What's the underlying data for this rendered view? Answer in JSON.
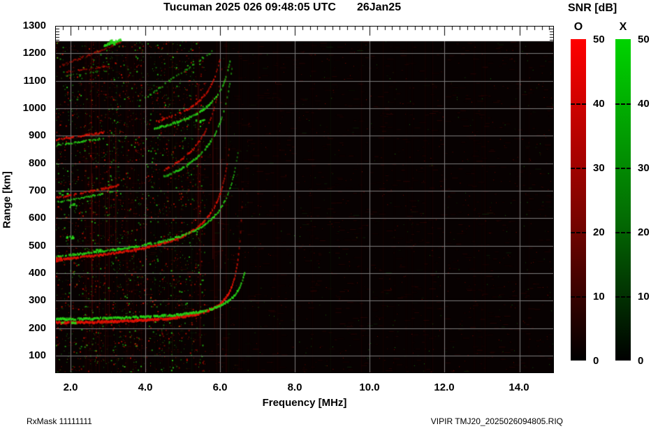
{
  "header": {
    "title": "Tucuman 2025 026 09:48:05 UTC",
    "date": "26Jan25"
  },
  "axes": {
    "x": {
      "label": "Frequency [MHz]",
      "ticks": [
        "2.0",
        "4.0",
        "6.0",
        "8.0",
        "10.0",
        "12.0",
        "14.0"
      ],
      "tick_values": [
        2,
        4,
        6,
        8,
        10,
        12,
        14
      ],
      "min": 1.6,
      "max": 15.0,
      "minor_step": 0.2
    },
    "y": {
      "label": "Range [km]",
      "ticks": [
        "1300",
        "1200",
        "1100",
        "1000",
        "900",
        "800",
        "700",
        "600",
        "500",
        "400",
        "300",
        "200",
        "100"
      ],
      "tick_values": [
        1300,
        1200,
        1100,
        1000,
        900,
        800,
        700,
        600,
        500,
        400,
        300,
        200,
        100
      ],
      "min": 30,
      "max": 1300,
      "minor_step": 10
    }
  },
  "legend": {
    "title": "SNR [dB]",
    "o_label": "O",
    "x_label": "X",
    "ticks": [
      "50",
      "40",
      "30",
      "20",
      "10",
      "0"
    ],
    "tick_values": [
      50,
      40,
      30,
      20,
      10,
      0
    ],
    "o_color_top": "#ff0000",
    "x_color_top": "#00d400",
    "bottom_color": "#000000",
    "min": 0,
    "max": 50
  },
  "footer": {
    "left": "RxMask 11111111",
    "right": "VIPIR  TMJ20_2025026094805.RIQ"
  },
  "chart_data": {
    "type": "heatmap",
    "title": "Tucuman 2025 026 09:48:05 UTC",
    "date": "26Jan25",
    "xlabel": "Frequency [MHz]",
    "ylabel": "Range [km]",
    "zlabel": "SNR [dB]",
    "x_range": [
      1.6,
      15.0
    ],
    "y_range": [
      30,
      1300
    ],
    "z_range": [
      0,
      50
    ],
    "x_gridlines": [
      2,
      4,
      6,
      8,
      10,
      12,
      14
    ],
    "y_gridlines": [
      100,
      200,
      300,
      400,
      500,
      600,
      700,
      800,
      900,
      1000,
      1100,
      1200
    ],
    "grid_color": "#7c7c7c",
    "background": "#070101",
    "no_data_band_km": [
      1245,
      1300
    ],
    "modes": {
      "o": {
        "name": "O",
        "color": "#ff1600"
      },
      "x": {
        "name": "X",
        "color": "#2bd41c"
      }
    },
    "critical_frequency_MHz": {
      "o_mode": 6.7,
      "x_mode": 7.0
    },
    "echo_traces": [
      {
        "hop": 1,
        "base_km": 219,
        "c": 58,
        "fc_o": 6.72,
        "tilt": 0,
        "segs": [
          [
            1.6,
            6.68
          ]
        ],
        "alpha": 1.0,
        "thick": 3.5,
        "patch": 0.95,
        "x_dr": 13,
        "rmax": 770,
        "points_o": [
          [
            1.6,
            219
          ],
          [
            3.0,
            224
          ],
          [
            5.0,
            242
          ],
          [
            6.0,
            288
          ],
          [
            6.5,
            471
          ],
          [
            6.65,
            740
          ]
        ]
      },
      {
        "hop": 2,
        "base_km": 447,
        "c": 140,
        "fc_o": 6.6,
        "tilt": 8,
        "segs": [
          [
            1.6,
            6.55
          ]
        ],
        "alpha": 0.95,
        "thick": 3.0,
        "patch": 0.85,
        "x_dr": 14,
        "rmax": 870,
        "points_o": [
          [
            1.6,
            447
          ],
          [
            3.0,
            462
          ],
          [
            4.2,
            498
          ],
          [
            5.0,
            520
          ],
          [
            6.0,
            665
          ],
          [
            6.4,
            860
          ]
        ]
      },
      {
        "hop": 3,
        "base_km": 673,
        "c": 200,
        "fc_o": 6.5,
        "tilt": 15,
        "segs": [
          [
            1.6,
            3.3
          ],
          [
            4.5,
            6.45
          ]
        ],
        "alpha": 0.8,
        "thick": 2.6,
        "patch": 0.6,
        "x_dr": -16,
        "rmax": 1150,
        "points_o": [
          [
            1.6,
            673
          ],
          [
            3.0,
            711
          ],
          [
            4.5,
            776
          ],
          [
            5.5,
            891
          ],
          [
            6.0,
            1099
          ]
        ]
      },
      {
        "hop": 4,
        "base_km": 885,
        "c": 100,
        "fc_o": 6.4,
        "tilt": 15,
        "segs": [
          [
            1.6,
            2.9
          ],
          [
            4.25,
            6.3
          ]
        ],
        "alpha": 0.9,
        "thick": 2.6,
        "patch": 0.65,
        "x_dr": -20,
        "rmax": 1180,
        "points_o": [
          [
            1.6,
            885
          ],
          [
            2.5,
            902
          ],
          [
            4.5,
            964
          ],
          [
            5.8,
            1115
          ]
        ]
      },
      {
        "hop": 5,
        "base_km": 1128,
        "c": 120,
        "fc_o": 6.3,
        "tilt": 10,
        "segs": [
          [
            1.9,
            3.1
          ]
        ],
        "alpha": 0.5,
        "thick": 2.0,
        "patch": 0.5,
        "x_dr": -14,
        "rmax": 1160,
        "points_o": [
          [
            1.9,
            1131
          ],
          [
            3.1,
            1155
          ]
        ]
      }
    ],
    "streaks": [
      {
        "pts": [
          [
            1.7,
            1152
          ],
          [
            3.35,
            1240
          ]
        ],
        "mode": "o",
        "alpha": 0.5,
        "thick": 2.5,
        "patch": 0.7
      },
      {
        "pts": [
          [
            4.0,
            1038
          ],
          [
            5.78,
            1205
          ]
        ],
        "mode": "x",
        "alpha": 0.7,
        "thick": 2.5,
        "patch": 0.45
      },
      {
        "pts": [
          [
            2.9,
            1228
          ],
          [
            3.35,
            1250
          ]
        ],
        "mode": "x",
        "alpha": 0.85,
        "thick": 2.5,
        "patch": 0.6
      }
    ],
    "blobs": [
      {
        "f": 1.78,
        "r": 232,
        "mode": "x",
        "s": 4,
        "n": 7
      },
      {
        "f": 2.08,
        "r": 228,
        "mode": "x",
        "s": 3,
        "n": 4
      },
      {
        "f": 1.66,
        "r": 452,
        "mode": "o",
        "s": 4,
        "n": 8
      },
      {
        "f": 1.94,
        "r": 535,
        "mode": "x",
        "s": 3,
        "n": 6
      },
      {
        "f": 2.65,
        "r": 487,
        "mode": "x",
        "s": 3,
        "n": 5
      },
      {
        "f": 2.05,
        "r": 648,
        "mode": "x",
        "s": 3,
        "n": 5
      },
      {
        "f": 1.8,
        "r": 695,
        "mode": "x",
        "s": 3,
        "n": 4
      },
      {
        "f": 5.45,
        "r": 960,
        "mode": "x",
        "s": 3,
        "n": 5
      },
      {
        "f": 3.05,
        "r": 1245,
        "mode": "x",
        "s": 3,
        "n": 5
      }
    ],
    "noise": {
      "seed": 20250126,
      "row_dashes": 1500,
      "dots_dense": 2600,
      "dots_sparse": 650,
      "stripes": 85,
      "bright_stripes": 10,
      "dense_f_max": 5.6
    }
  }
}
